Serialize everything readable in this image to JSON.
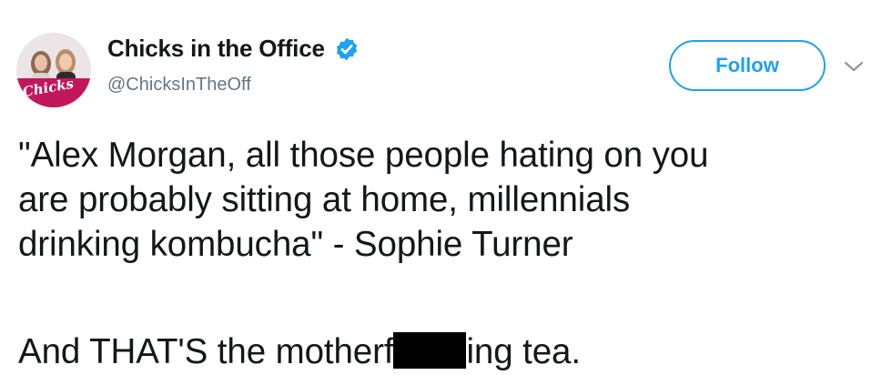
{
  "author": {
    "display_name": "Chicks in the Office",
    "handle": "@ChicksInTheOff",
    "verified": true,
    "avatar_logo_text": "Chicks"
  },
  "actions": {
    "follow_label": "Follow",
    "menu_icon": "chevron-down-icon"
  },
  "tweet": {
    "lines": [
      "\"Alex Morgan, all those people hating on you",
      "are probably sitting at home, millennials",
      "drinking kombucha\" - Sophie Turner"
    ],
    "last_line_before": "And THAT'S the motherf",
    "last_line_after": "ing tea."
  },
  "colors": {
    "accent": "#1da1f2",
    "text": "#14171a",
    "secondary_text": "#657786",
    "avatar_banner": "#c2185b"
  }
}
